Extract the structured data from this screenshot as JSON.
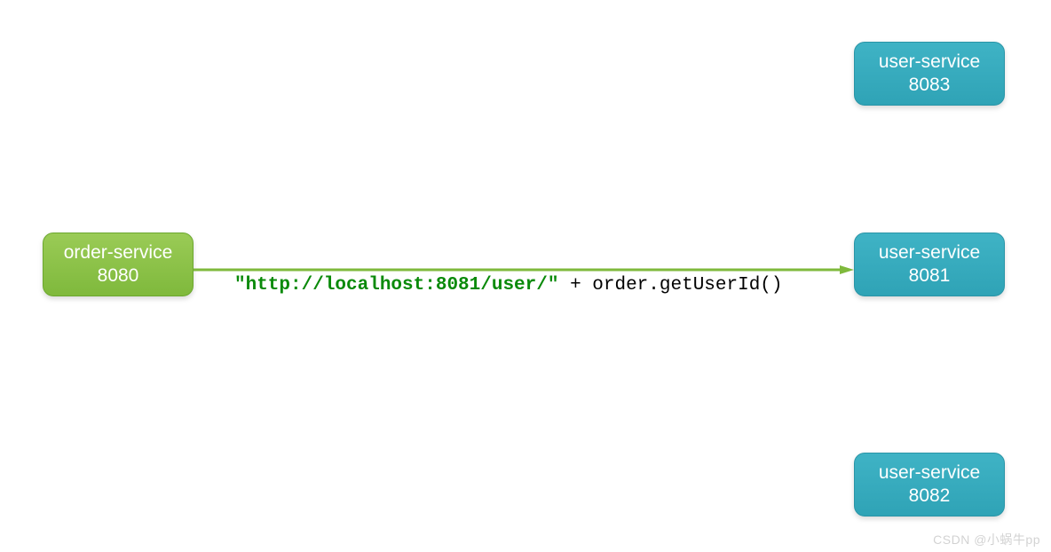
{
  "diagram": {
    "order_service": {
      "name": "order-service",
      "port": "8080"
    },
    "user_services": [
      {
        "name": "user-service",
        "port": "8083"
      },
      {
        "name": "user-service",
        "port": "8081"
      },
      {
        "name": "user-service",
        "port": "8082"
      }
    ],
    "arrow": {
      "color": "#7fb93c",
      "from": "order-service-8080",
      "to": "user-service-8081"
    },
    "request_label": {
      "url": "\"http://localhost:8081/user/\"",
      "suffix": " + order.getUserId()"
    }
  },
  "watermark": "CSDN @小蜗牛pp"
}
